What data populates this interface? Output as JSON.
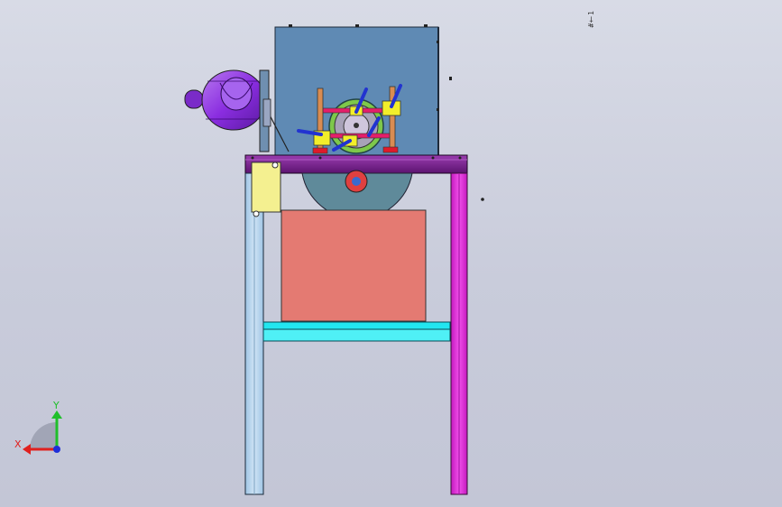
{
  "viewport": {
    "background_top": "#d8dbe6",
    "background_bottom": "#c3c6d6"
  },
  "triad": {
    "x_label": "X",
    "y_label": "Y",
    "x_color": "#e0201e",
    "y_color": "#1fbf2a",
    "z_color": "#1f2fd8"
  },
  "corner_annotation": "#†1",
  "model_colors": {
    "cabinet": "#5f8ab4",
    "motor": "#8a2de0",
    "top_plate": "#7a1f8a",
    "left_leg": "#b9d7f0",
    "right_leg": "#e81ee0",
    "crossbar": "#22e6f0",
    "panel": "#e47a72",
    "bracket": "#f2ee7a"
  }
}
